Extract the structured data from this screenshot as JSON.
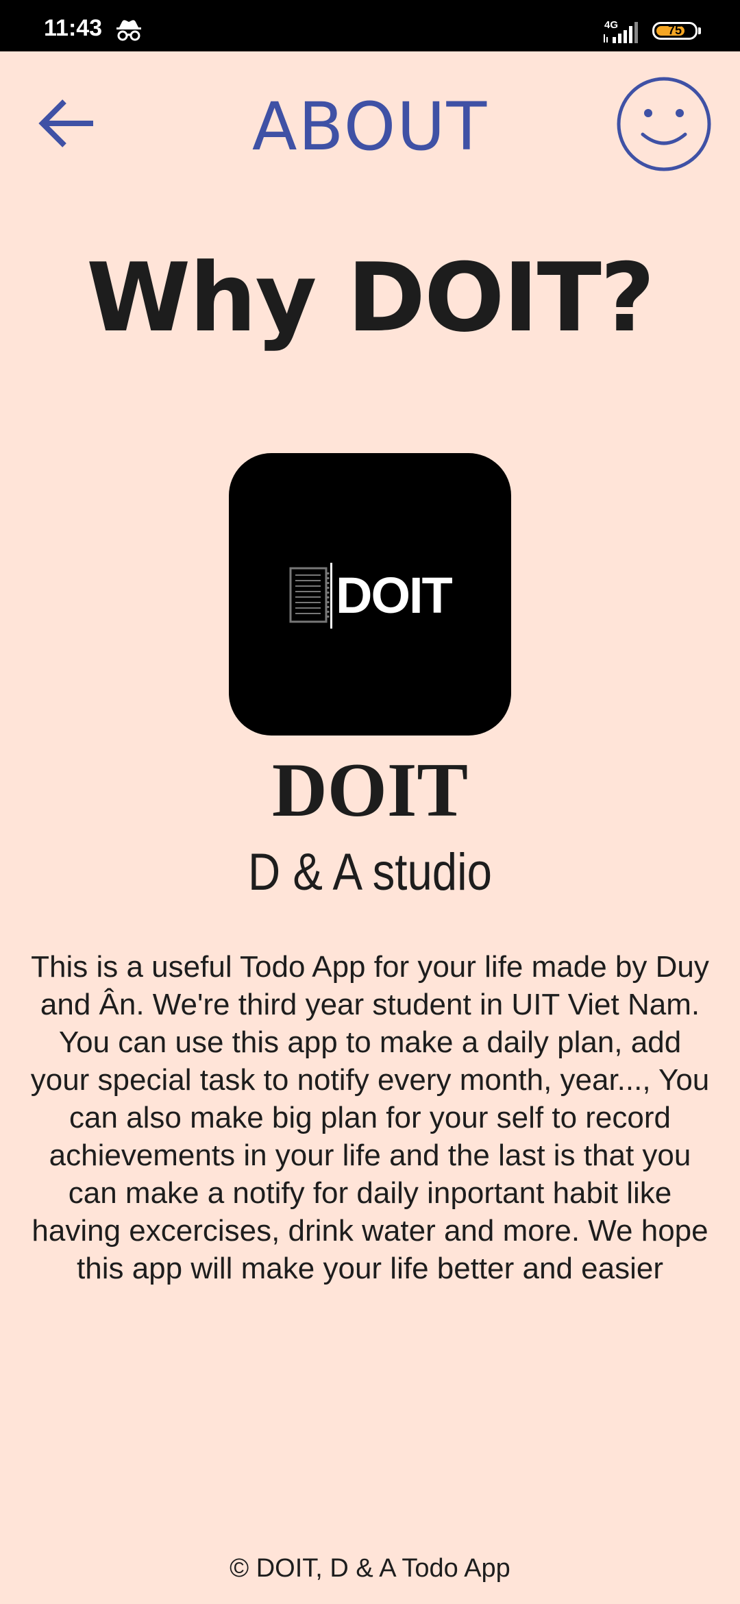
{
  "status_bar": {
    "time": "11:43",
    "network": "4G",
    "battery_level": "75",
    "battery_fraction": 0.75,
    "battery_color": "#f5a623"
  },
  "header": {
    "back_icon": "arrow-left-icon",
    "title": "ABOUT",
    "profile_icon": "smiley-face-icon",
    "accent_color": "#3f51a5"
  },
  "main": {
    "heading": "Why DOIT?",
    "logo": {
      "text": "DOIT"
    },
    "app_name": "DOIT",
    "studio": "D & A studio",
    "description": "This is a useful Todo App for your life made by Duy and Ân. We're third year student in UIT Viet Nam. You can use this app to make a daily plan, add your special task to notify every month, year..., You can also make big plan for your self to record achievements in your life and the last is that you can make a notify for daily inportant habit like having excercises, drink water and more. We hope this app will make your life better and easier"
  },
  "footer": {
    "text": "© DOIT, D & A Todo App"
  },
  "colors": {
    "background": "#ffe4d8",
    "text": "#1d1d1d"
  }
}
